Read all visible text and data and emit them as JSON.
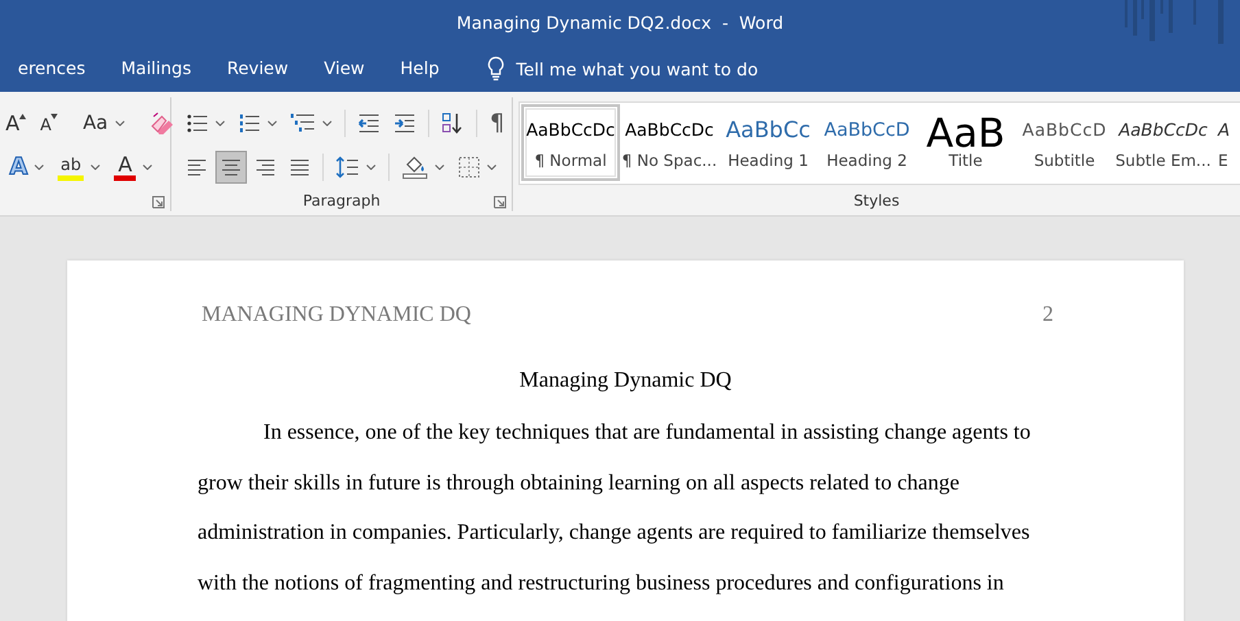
{
  "window": {
    "title": "Managing Dynamic DQ2.docx  -  Word"
  },
  "tabs": [
    {
      "label": "erences",
      "selected": false
    },
    {
      "label": "Mailings",
      "selected": false
    },
    {
      "label": "Review",
      "selected": false
    },
    {
      "label": "View",
      "selected": false
    },
    {
      "label": "Help",
      "selected": false
    }
  ],
  "tell_me": {
    "placeholder": "Tell me what you want to do"
  },
  "font_group": {
    "row1": [
      {
        "kind": "grow",
        "glyph": "A"
      },
      {
        "kind": "shrink",
        "glyph": "A"
      },
      {
        "kind": "case",
        "glyph": "Aa"
      },
      {
        "kind": "clear"
      }
    ],
    "row2": [
      {
        "kind": "effects",
        "glyph": "A"
      },
      {
        "kind": "highlight",
        "glyph": "ab"
      },
      {
        "kind": "color",
        "glyph": "A"
      }
    ]
  },
  "paragraph_group": {
    "label": "Paragraph",
    "row1": [
      {
        "kind": "bullets"
      },
      {
        "kind": "numbering"
      },
      {
        "kind": "multilevel"
      },
      {
        "kind": "outdent"
      },
      {
        "kind": "indent"
      },
      {
        "kind": "sort"
      },
      {
        "kind": "marks",
        "glyph": "¶"
      }
    ],
    "row2": [
      {
        "kind": "align_left",
        "selected": false
      },
      {
        "kind": "align_center",
        "selected": true
      },
      {
        "kind": "align_right",
        "selected": false
      },
      {
        "kind": "justify",
        "selected": false
      },
      {
        "kind": "spacing"
      },
      {
        "kind": "shading"
      },
      {
        "kind": "borders"
      }
    ]
  },
  "styles_group": {
    "label": "Styles",
    "items": [
      {
        "kind": "normal",
        "preview": "AaBbCcDc",
        "name": "¶ Normal",
        "selected": true
      },
      {
        "kind": "normal",
        "preview": "AaBbCcDc",
        "name": "¶ No Spac...",
        "selected": false
      },
      {
        "kind": "heading1",
        "preview": "AaBbCc",
        "name": "Heading 1",
        "selected": false
      },
      {
        "kind": "heading2",
        "preview": "AaBbCcD",
        "name": "Heading 2",
        "selected": false
      },
      {
        "kind": "title",
        "preview": "AaB",
        "name": "Title",
        "selected": false
      },
      {
        "kind": "subtitle",
        "preview": "AaBbCcD",
        "name": "Subtitle",
        "selected": false
      },
      {
        "kind": "emphasis",
        "preview": "AaBbCcDc",
        "name": "Subtle Em...",
        "selected": false
      },
      {
        "kind": "emphasis",
        "preview": "A",
        "name": "E",
        "selected": false
      }
    ]
  },
  "document": {
    "header": "MANAGING DYNAMIC DQ",
    "page_number": "2",
    "title": "Managing Dynamic DQ",
    "paragraph_lines": [
      "In essence, one of the key techniques that are fundamental in assisting change agents to",
      "grow their skills in future is through obtaining learning on all aspects related to change",
      "administration in companies. Particularly, change agents are required to familiarize themselves",
      "with the notions of fragmenting and restructuring business procedures and configurations in"
    ]
  }
}
